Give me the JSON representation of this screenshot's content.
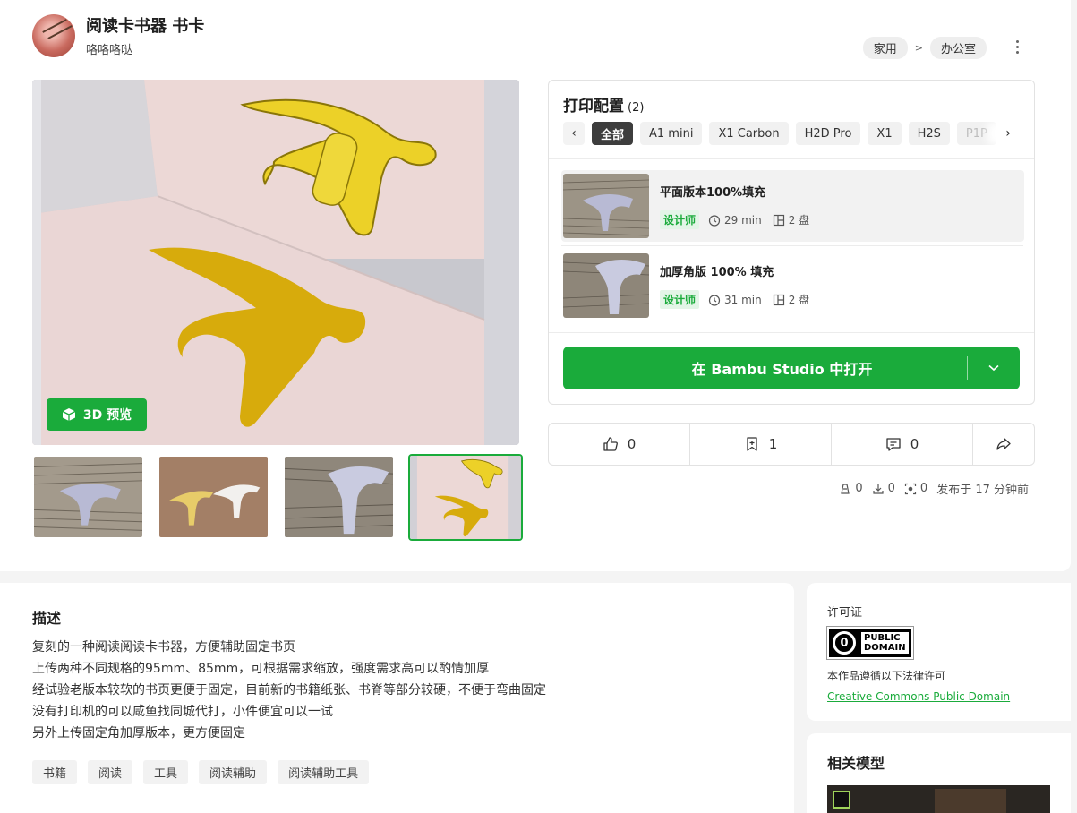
{
  "header": {
    "title": "阅读卡书器 书卡",
    "author": "咯咯咯哒",
    "breadcrumb": [
      "家用",
      "办公室"
    ],
    "breadcrumb_sep": ">"
  },
  "gallery": {
    "preview_3d_label": "3D 预览",
    "thumbnails": [
      "thumbnail-1",
      "thumbnail-2",
      "thumbnail-3",
      "thumbnail-4"
    ],
    "active_index": 3
  },
  "print_config": {
    "title": "打印配置",
    "count": "(2)",
    "filters": [
      "全部",
      "A1 mini",
      "X1 Carbon",
      "H2D Pro",
      "X1",
      "H2S",
      "P1P"
    ],
    "active_filter": "全部",
    "profiles": [
      {
        "name": "平面版本100%填充",
        "badge": "设计师",
        "time": "29 min",
        "plates": "2 盘"
      },
      {
        "name": "加厚角版 100% 填充",
        "badge": "设计师",
        "time": "31 min",
        "plates": "2 盘"
      }
    ],
    "open_button": "在 Bambu Studio 中打开"
  },
  "actions": {
    "likes": "0",
    "collects": "1",
    "comments": "0"
  },
  "stats": {
    "prints": "0",
    "downloads": "0",
    "boosts": "0",
    "published": "发布于 17 分钟前"
  },
  "description": {
    "title": "描述",
    "line1": "复刻的一种阅读阅读卡书器，方便辅助固定书页",
    "line2": "上传两种不同规格的95mm、85mm，可根据需求缩放，强度需求高可以酌情加厚",
    "line3_a": "经试验老版本",
    "line3_b": "较软的书页更便于固定",
    "line3_c": "，目前",
    "line3_d": "新的书籍",
    "line3_e": "纸张、书脊等部分较硬，",
    "line3_f": "不便于弯曲固定",
    "line4": "没有打印机的可以咸鱼找同城代打，小件便宜可以一试",
    "line5": "另外上传固定角加厚版本，更方便固定",
    "tags": [
      "书籍",
      "阅读",
      "工具",
      "阅读辅助",
      "阅读辅助工具"
    ]
  },
  "license": {
    "title": "许可证",
    "badge_line1": "PUBLIC",
    "badge_line2": "DOMAIN",
    "note": "本作品遵循以下法律许可",
    "link": "Creative Commons Public Domain"
  },
  "related": {
    "title": "相关模型"
  },
  "colors": {
    "accent": "#1aab3b",
    "gold": "#e8c21b",
    "dark_gold": "#c9a10a"
  }
}
